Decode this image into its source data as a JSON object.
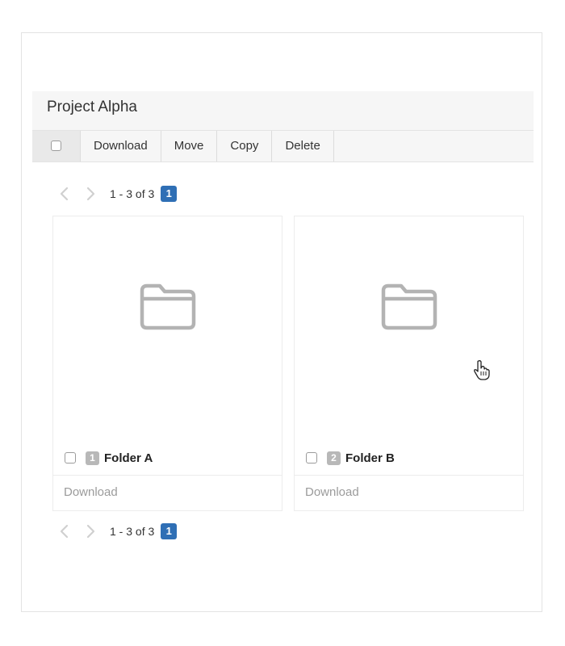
{
  "header": {
    "title": "Project Alpha"
  },
  "toolbar": {
    "buttons": [
      "Download",
      "Move",
      "Copy",
      "Delete"
    ]
  },
  "pagination": {
    "range_text": "1 - 3 of 3",
    "current_page": "1"
  },
  "items": [
    {
      "index": "1",
      "name": "Folder A",
      "action": "Download",
      "icon": "folder-icon"
    },
    {
      "index": "2",
      "name": "Folder B",
      "action": "Download",
      "icon": "folder-icon"
    }
  ],
  "colors": {
    "accent": "#2f6fb5",
    "toolbar_bg": "#f6f6f6",
    "badge_gray": "#b8b8b8",
    "muted_text": "#9b9b9b"
  }
}
